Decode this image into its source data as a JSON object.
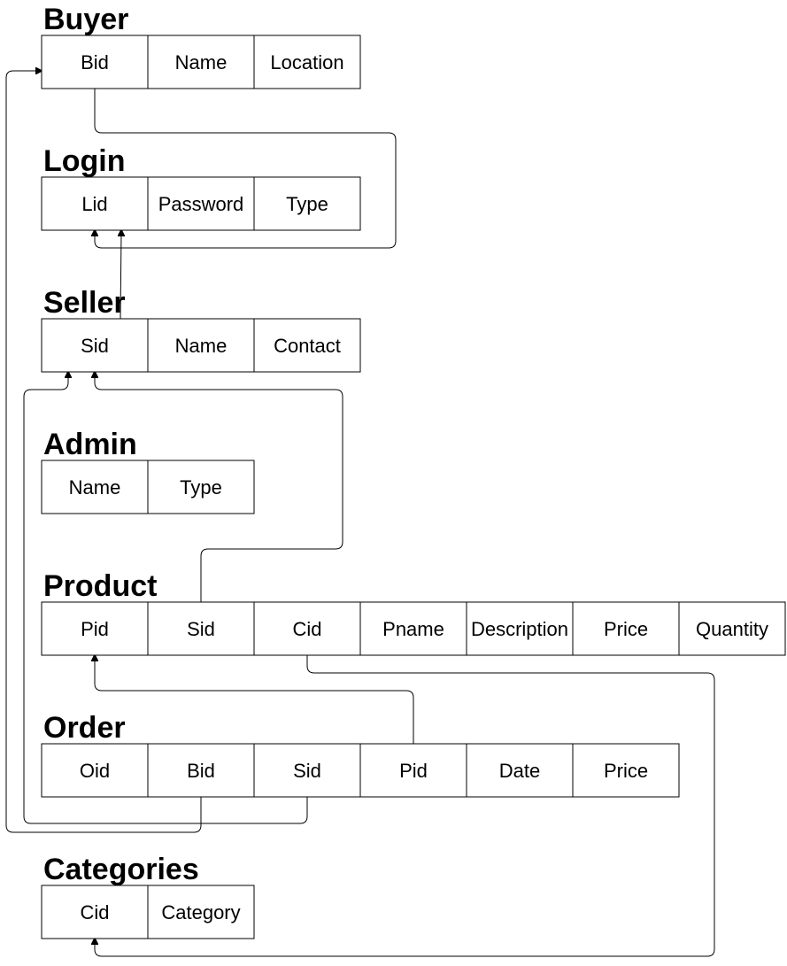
{
  "tables": [
    {
      "id": "buyer",
      "title": "Buyer",
      "columns": [
        "Bid",
        "Name",
        "Location"
      ]
    },
    {
      "id": "login",
      "title": "Login",
      "columns": [
        "Lid",
        "Password",
        "Type"
      ]
    },
    {
      "id": "seller",
      "title": "Seller",
      "columns": [
        "Sid",
        "Name",
        "Contact"
      ]
    },
    {
      "id": "admin",
      "title": "Admin",
      "columns": [
        "Name",
        "Type"
      ]
    },
    {
      "id": "product",
      "title": "Product",
      "columns": [
        "Pid",
        "Sid",
        "Cid",
        "Pname",
        "Description",
        "Price",
        "Quantity"
      ]
    },
    {
      "id": "order",
      "title": "Order",
      "columns": [
        "Oid",
        "Bid",
        "Sid",
        "Pid",
        "Date",
        "Price"
      ]
    },
    {
      "id": "categories",
      "title": "Categories",
      "columns": [
        "Cid",
        "Category"
      ]
    }
  ]
}
